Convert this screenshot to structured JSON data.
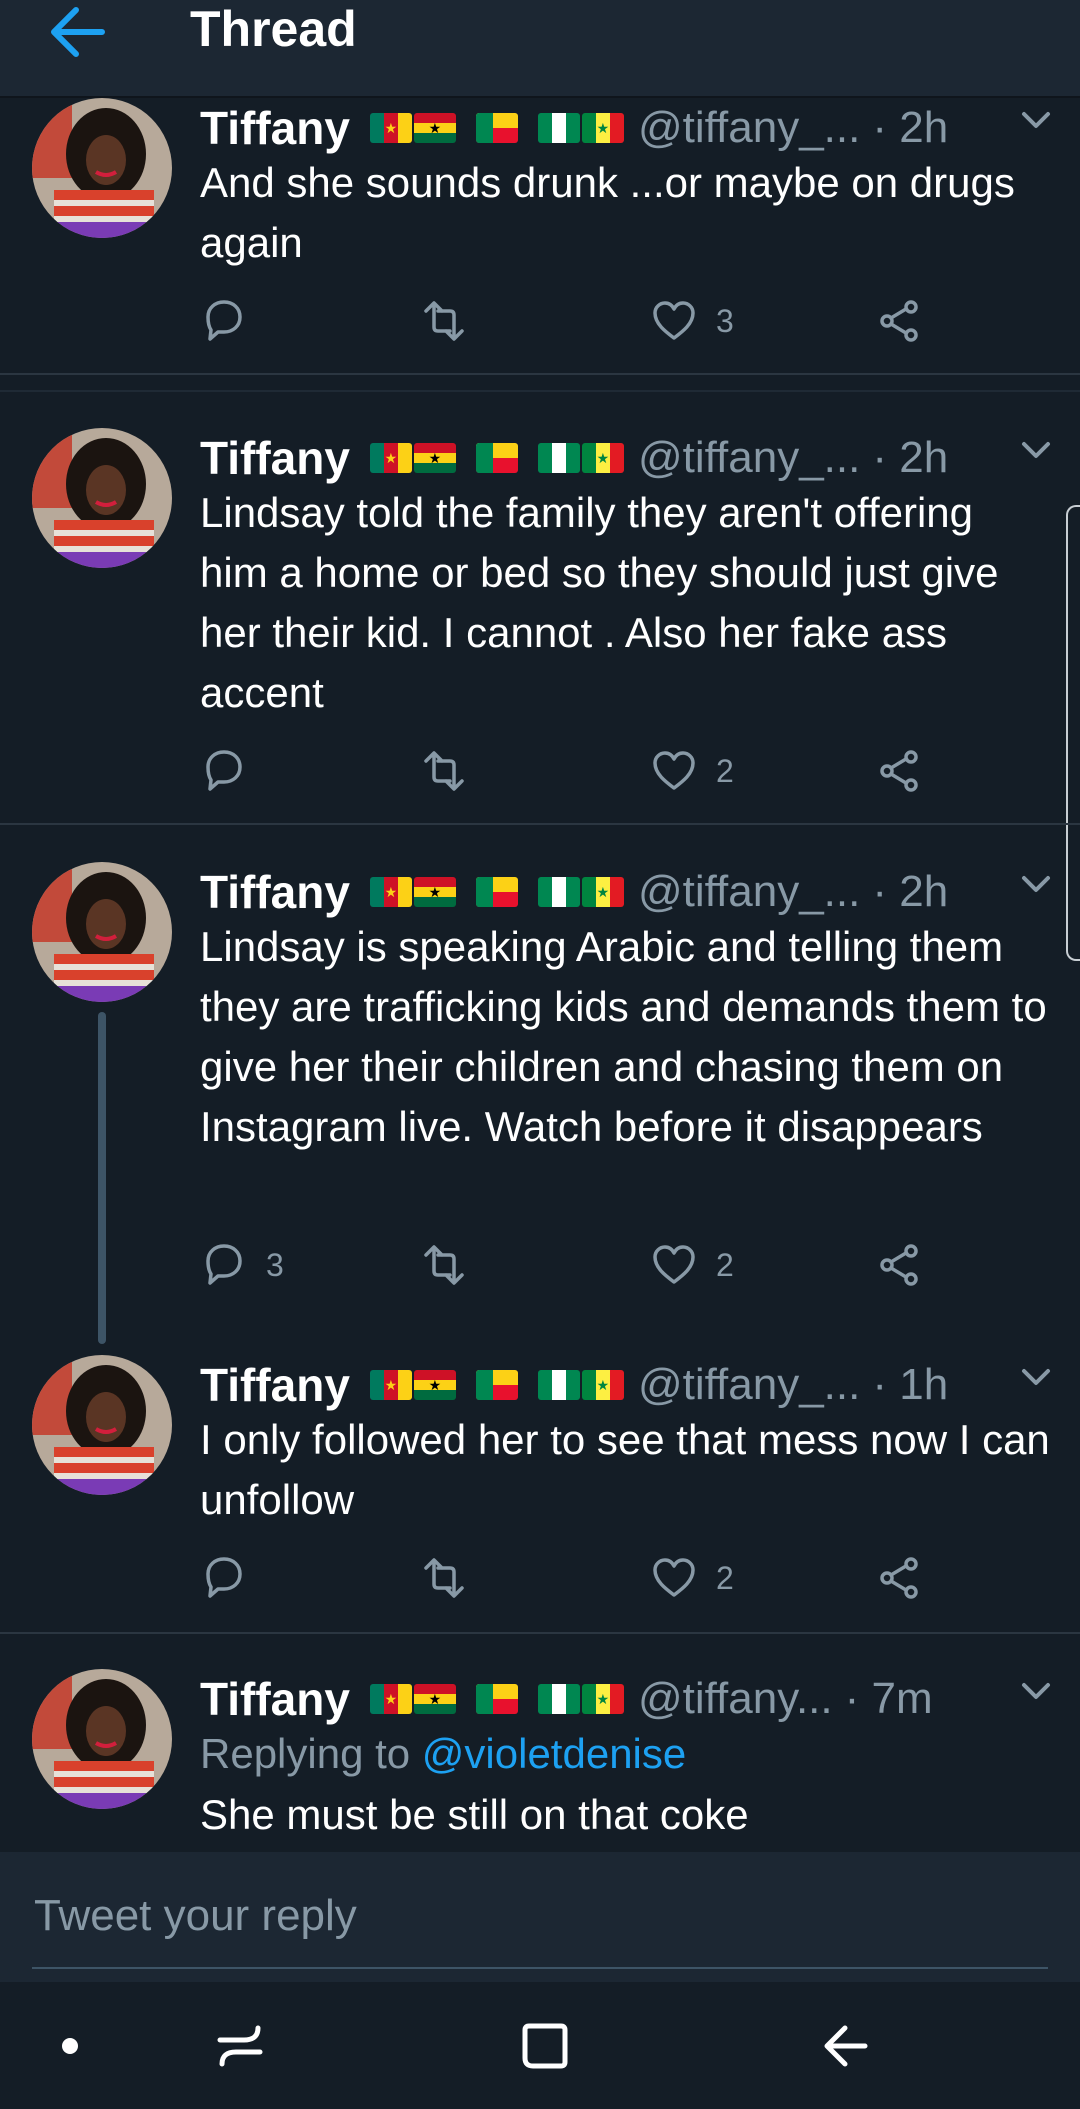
{
  "header": {
    "title": "Thread",
    "back_icon": "arrow-left-icon"
  },
  "colors": {
    "accent": "#1da1f2",
    "background": "#141d26",
    "header_bg": "#1c2733",
    "muted": "#8899a6"
  },
  "tweets": [
    {
      "name": "Tiffany",
      "flags": [
        "Cameroon",
        "Ghana",
        "Benin",
        "Nigeria",
        "Senegal"
      ],
      "handle": "@tiffany_...",
      "time": "· 2h",
      "text": "And she sounds drunk ...or maybe on drugs again",
      "replies": "",
      "retweets": "",
      "likes": "3"
    },
    {
      "name": "Tiffany",
      "flags": [
        "Cameroon",
        "Ghana",
        "Benin",
        "Nigeria",
        "Senegal"
      ],
      "handle": "@tiffany_...",
      "time": "· 2h",
      "text": "Lindsay told the family they aren't offering him a home or bed so they should just give her their kid. I cannot . Also her fake ass accent",
      "replies": "",
      "retweets": "",
      "likes": "2"
    },
    {
      "name": "Tiffany",
      "flags": [
        "Cameroon",
        "Ghana",
        "Benin",
        "Nigeria",
        "Senegal"
      ],
      "handle": "@tiffany_...",
      "time": "· 2h",
      "text": "Lindsay is  speaking Arabic and telling them they are trafficking kids and demands them to give her their children and chasing them on Instagram live. Watch before it disappears",
      "replies": "3",
      "retweets": "",
      "likes": "2"
    },
    {
      "name": "Tiffany",
      "flags": [
        "Cameroon",
        "Ghana",
        "Benin",
        "Nigeria",
        "Senegal"
      ],
      "handle": "@tiffany_...",
      "time": "· 1h",
      "text": "I only followed her to see that mess now I can unfollow",
      "replies": "",
      "retweets": "",
      "likes": "2"
    },
    {
      "name": "Tiffany",
      "flags": [
        "Cameroon",
        "Ghana",
        "Benin",
        "Nigeria",
        "Senegal"
      ],
      "handle": "@tiffany...",
      "time": "· 7m",
      "replying_prefix": "Replying to",
      "replying_to": "@violetdenise",
      "text": "She must be still on that coke"
    }
  ],
  "composer": {
    "placeholder": "Tweet your reply"
  },
  "navbar": {
    "icons": [
      "dot-icon",
      "recent-apps-icon",
      "home-icon",
      "back-icon"
    ]
  }
}
